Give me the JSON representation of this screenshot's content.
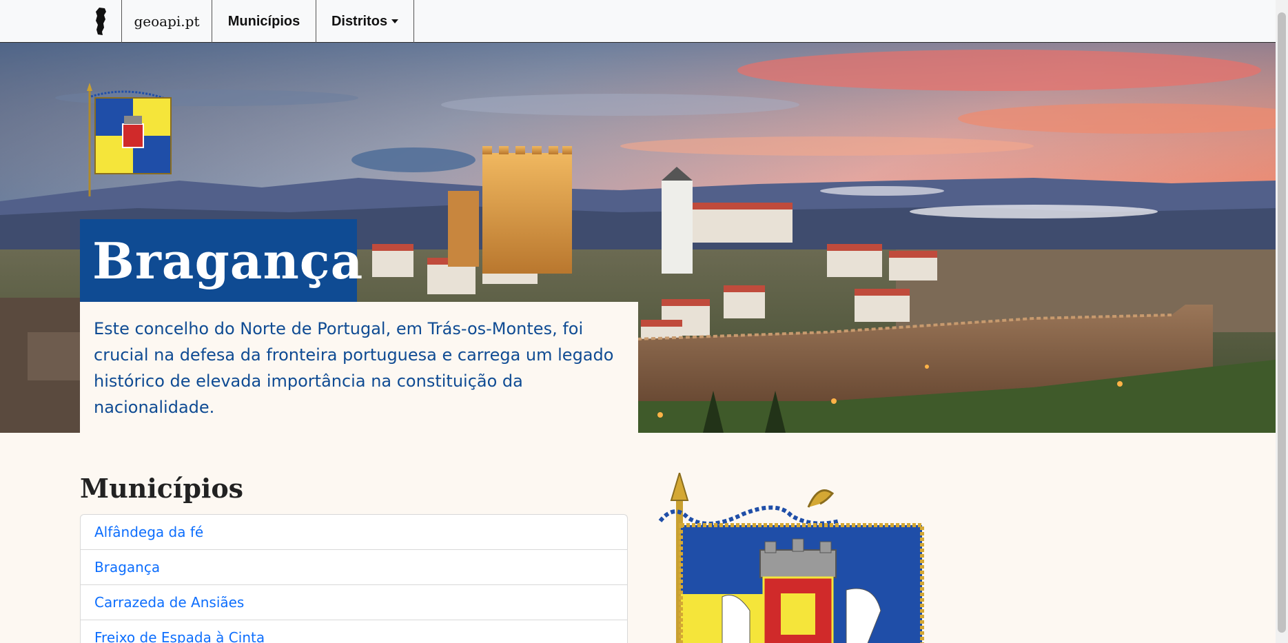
{
  "navbar": {
    "logo_icon": "portugal-map-icon",
    "brand": "geoapi.pt",
    "municipios": "Municípios",
    "distritos": "Distritos"
  },
  "hero": {
    "title": "Bragança",
    "description": "Este concelho do Norte de Portugal, em Trás-os-Montes, foi crucial na defesa da fronteira portuguesa e carrega um legado histórico de elevada importância na constituição da nacionalidade.",
    "flag_icon": "braganca-flag-icon"
  },
  "section": {
    "title": "Municípios"
  },
  "municipios": [
    {
      "label": "Alfândega da fé"
    },
    {
      "label": "Bragança"
    },
    {
      "label": "Carrazeda de Ansiães"
    },
    {
      "label": "Freixo de Espada à Cinta"
    }
  ],
  "colors": {
    "title_bg": "#0f4b93",
    "text_blue": "#0f4b93",
    "link_blue": "#0d6efd",
    "page_bg": "#fdf8f2",
    "flag_blue": "#1f4ea8",
    "flag_yellow": "#f5e53a"
  }
}
